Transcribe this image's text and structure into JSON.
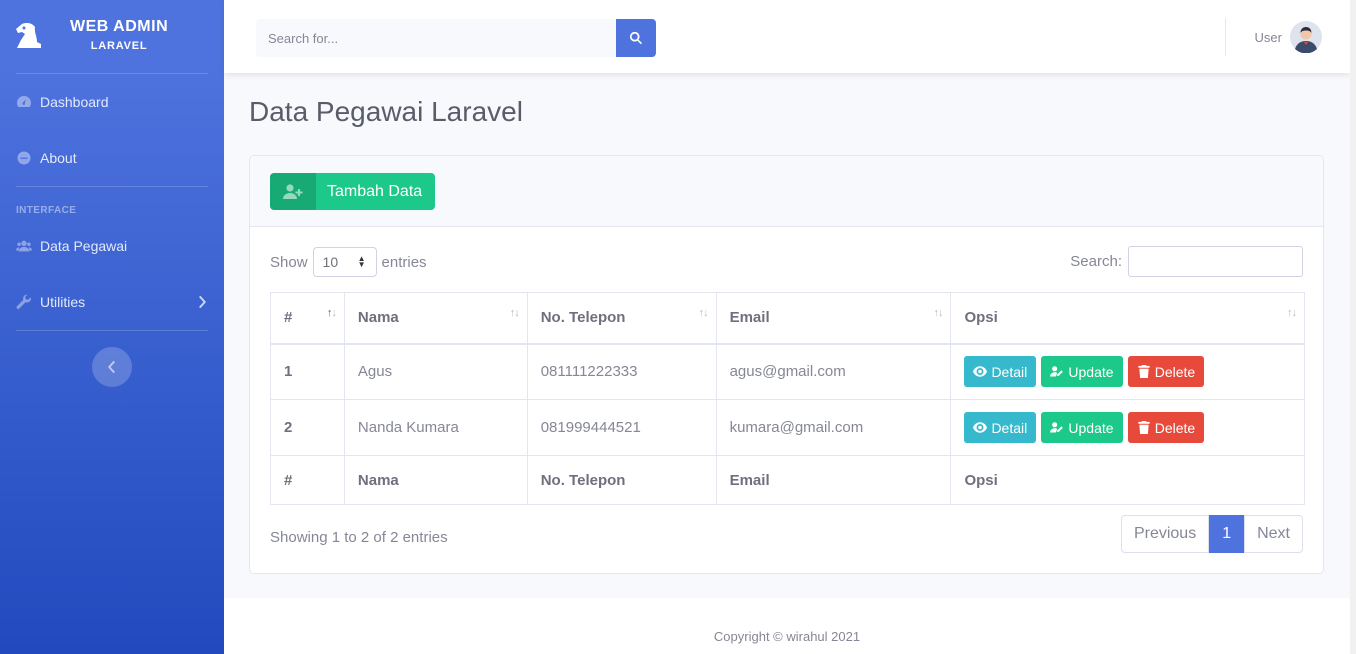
{
  "brand": {
    "title": "WEB ADMIN",
    "subtitle": "LARAVEL",
    "logo_icon": "knight-chess-icon"
  },
  "sidebar": {
    "dashboard": "Dashboard",
    "about": "About",
    "heading_interface": "INTERFACE",
    "data_pegawai": "Data Pegawai",
    "utilities": "Utilities"
  },
  "topbar": {
    "search_placeholder": "Search for...",
    "user_name": "User"
  },
  "page": {
    "title": "Data Pegawai Laravel"
  },
  "card": {
    "add_button": "Tambah Data",
    "length_show": "Show",
    "length_value": "10",
    "length_entries": "entries",
    "search_label": "Search:",
    "columns": [
      "#",
      "Nama",
      "No. Telepon",
      "Email",
      "Opsi"
    ],
    "rows": [
      {
        "no": "1",
        "nama": "Agus",
        "telepon": "081111222333",
        "email": "agus@gmail.com"
      },
      {
        "no": "2",
        "nama": "Nanda Kumara",
        "telepon": "081999444521",
        "email": "kumara@gmail.com"
      }
    ],
    "actions": {
      "detail": "Detail",
      "update": "Update",
      "delete": "Delete"
    },
    "info": "Showing 1 to 2 of 2 entries",
    "pagination": {
      "previous": "Previous",
      "current": "1",
      "next": "Next"
    }
  },
  "footer": {
    "copyright": "Copyright © wirahul 2021"
  },
  "colors": {
    "primary": "#4e73df",
    "success": "#1cc88a",
    "info": "#36b9cc",
    "danger": "#e74a3b"
  }
}
